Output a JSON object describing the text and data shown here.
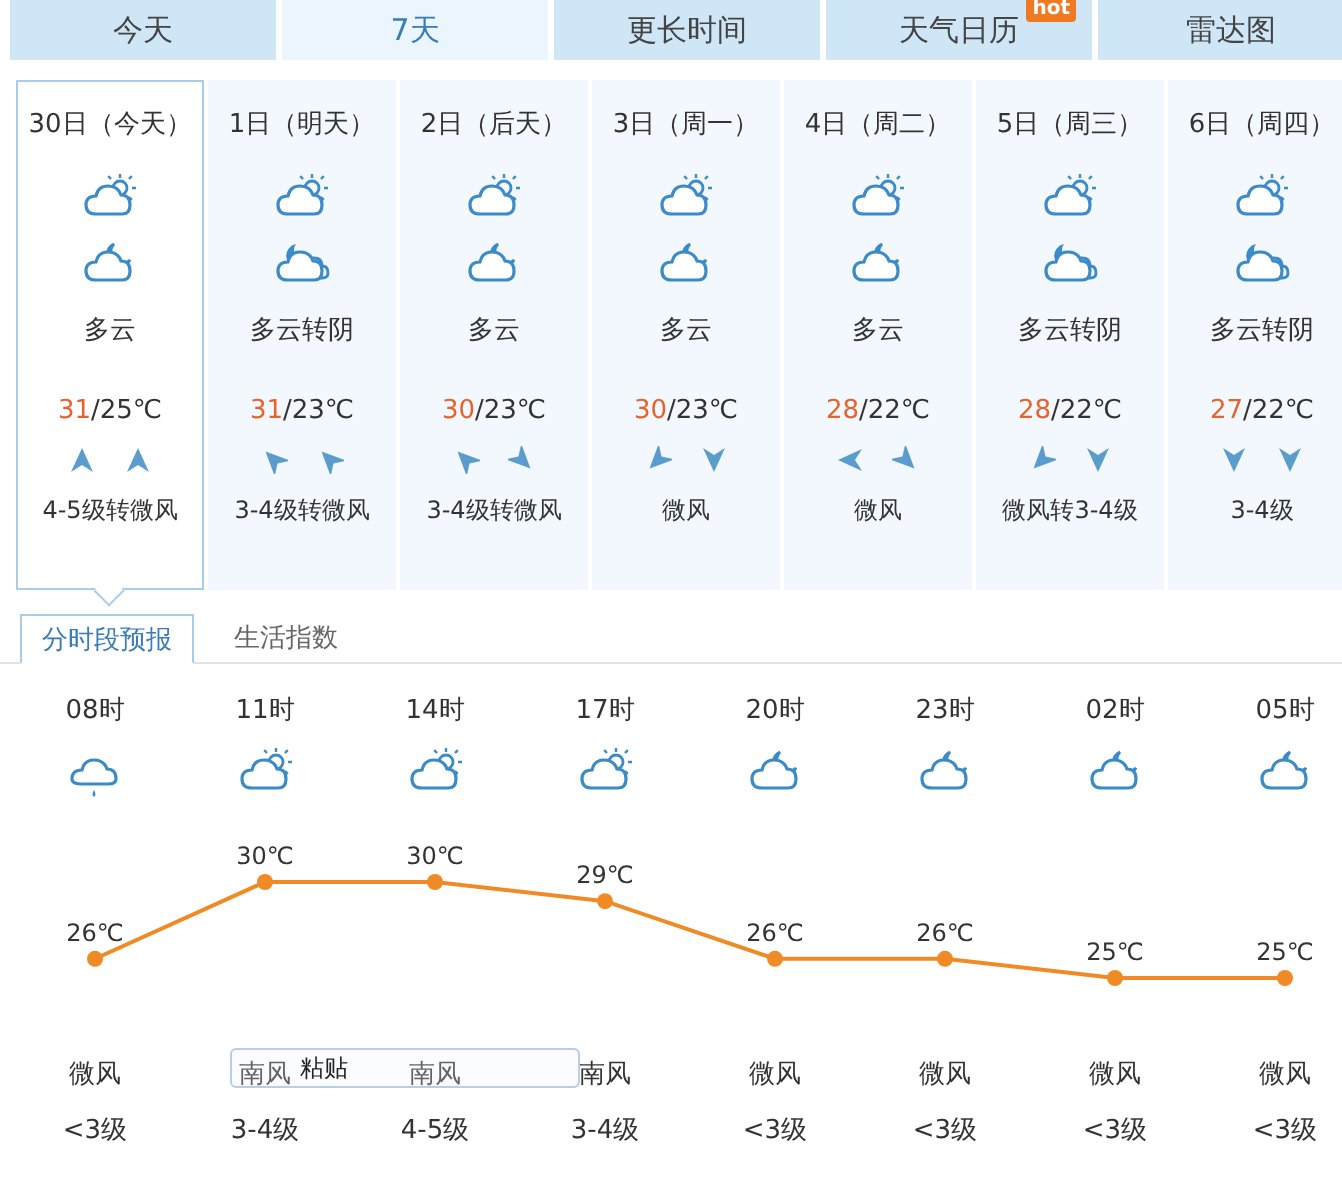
{
  "tabs": [
    {
      "label": "今天",
      "selected": false
    },
    {
      "label": "7天",
      "selected": true
    },
    {
      "label": "更长时间",
      "selected": false
    },
    {
      "label": "天气日历",
      "selected": false,
      "badge": "hot"
    },
    {
      "label": "雷达图",
      "selected": false
    }
  ],
  "days": [
    {
      "date": "30日（今天）",
      "selected": true,
      "icons": [
        {
          "kind": "sun_cloud"
        },
        {
          "kind": "moon_cloud"
        }
      ],
      "weather": "多云",
      "high": "31",
      "low": "/25℃",
      "arrows": [
        {
          "kind": "n"
        },
        {
          "kind": "n"
        }
      ],
      "wind": "4-5级转微风"
    },
    {
      "date": "1日（明天）",
      "selected": false,
      "icons": [
        {
          "kind": "sun_cloud"
        },
        {
          "kind": "moon_overcast"
        }
      ],
      "weather": "多云转阴",
      "high": "31",
      "low": "/23℃",
      "arrows": [
        {
          "kind": "nw"
        },
        {
          "kind": "nw"
        }
      ],
      "wind": "3-4级转微风"
    },
    {
      "date": "2日（后天）",
      "selected": false,
      "icons": [
        {
          "kind": "sun_cloud"
        },
        {
          "kind": "moon_cloud"
        }
      ],
      "weather": "多云",
      "high": "30",
      "low": "/23℃",
      "arrows": [
        {
          "kind": "nw"
        },
        {
          "kind": "se"
        }
      ],
      "wind": "3-4级转微风"
    },
    {
      "date": "3日（周一）",
      "selected": false,
      "icons": [
        {
          "kind": "sun_cloud"
        },
        {
          "kind": "moon_cloud"
        }
      ],
      "weather": "多云",
      "high": "30",
      "low": "/23℃",
      "arrows": [
        {
          "kind": "sw"
        },
        {
          "kind": "s"
        }
      ],
      "wind": "微风"
    },
    {
      "date": "4日（周二）",
      "selected": false,
      "icons": [
        {
          "kind": "sun_cloud"
        },
        {
          "kind": "moon_cloud"
        }
      ],
      "weather": "多云",
      "high": "28",
      "low": "/22℃",
      "arrows": [
        {
          "kind": "w"
        },
        {
          "kind": "se"
        }
      ],
      "wind": "微风"
    },
    {
      "date": "5日（周三）",
      "selected": false,
      "icons": [
        {
          "kind": "sun_cloud"
        },
        {
          "kind": "moon_overcast"
        }
      ],
      "weather": "多云转阴",
      "high": "28",
      "low": "/22℃",
      "arrows": [
        {
          "kind": "sw"
        },
        {
          "kind": "s"
        }
      ],
      "wind": "微风转3-4级"
    },
    {
      "date": "6日（周四）",
      "selected": false,
      "icons": [
        {
          "kind": "sun_cloud"
        },
        {
          "kind": "moon_overcast"
        }
      ],
      "weather": "多云转阴",
      "high": "27",
      "low": "/22℃",
      "arrows": [
        {
          "kind": "s"
        },
        {
          "kind": "s"
        }
      ],
      "wind": "3-4级"
    }
  ],
  "sub_tabs": [
    {
      "label": "分时段预报",
      "selected": true
    },
    {
      "label": "生活指数",
      "selected": false
    }
  ],
  "hours": [
    {
      "time": "08时",
      "kind": "rain",
      "wind": "微风",
      "level_text": "<3级"
    },
    {
      "time": "11时",
      "kind": "sun_cloud",
      "wind": "南风",
      "level_text": "3-4级"
    },
    {
      "time": "14时",
      "kind": "sun_cloud",
      "wind": "南风",
      "level_text": "4-5级"
    },
    {
      "time": "17时",
      "kind": "sun_cloud",
      "wind": "南风",
      "level_text": "3-4级"
    },
    {
      "time": "20时",
      "kind": "moon_cloud",
      "wind": "微风",
      "level_text": "<3级"
    },
    {
      "time": "23时",
      "kind": "moon_cloud",
      "wind": "微风",
      "level_text": "<3级"
    },
    {
      "time": "02时",
      "kind": "moon_cloud",
      "wind": "微风",
      "level_text": "<3级"
    },
    {
      "time": "05时",
      "kind": "moon_cloud",
      "wind": "微风",
      "level_text": "<3级"
    }
  ],
  "chart_data": {
    "type": "line",
    "data_labels": true,
    "value_labels": [
      "26℃",
      "30℃",
      "30℃",
      "29℃",
      "26℃",
      "26℃",
      "25℃",
      "25℃"
    ],
    "series": [
      {
        "color": "#f08a24",
        "marker": "circle",
        "values": [
          26,
          30,
          30,
          29,
          26,
          26,
          25,
          25
        ]
      }
    ]
  },
  "paste_popup": {
    "label": "粘贴"
  }
}
